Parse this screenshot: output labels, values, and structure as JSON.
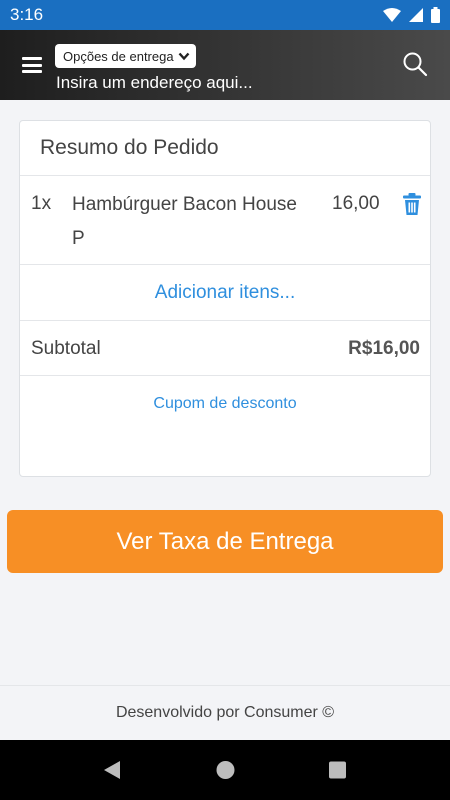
{
  "status_bar": {
    "time": "3:16",
    "icons": [
      "wifi-icon",
      "signal-icon",
      "battery-icon"
    ]
  },
  "header": {
    "menu_icon": "hamburger-menu-icon",
    "delivery_options_label": "Opções de entrega",
    "address_placeholder": "Insira um endereço aqui...",
    "search_icon": "search-icon"
  },
  "order_summary": {
    "title": "Resumo do Pedido",
    "items": [
      {
        "qty": "1x",
        "name": "Hambúrguer Bacon House P",
        "price": "16,00",
        "delete_icon": "trash-icon"
      }
    ],
    "add_items_label": "Adicionar itens...",
    "subtotal_label": "Subtotal",
    "subtotal_value": "R$16,00",
    "coupon_label": "Cupom de desconto"
  },
  "cta_label": "Ver Taxa de Entrega",
  "footer_text": "Desenvolvido por Consumer ©",
  "colors": {
    "status_bar": "#1a6fc1",
    "cta": "#f78f25",
    "link": "#2f8fde"
  }
}
